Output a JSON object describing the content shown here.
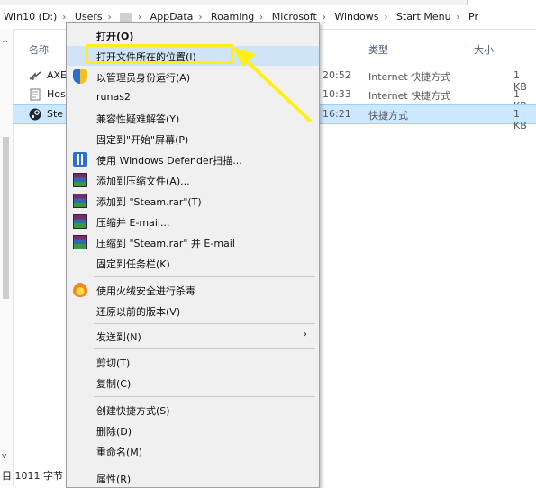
{
  "address": {
    "crumbs": [
      "WIn10 (D:)",
      "Users",
      "",
      "AppData",
      "Roaming",
      "Microsoft",
      "Windows",
      "Start Menu",
      "Pr"
    ],
    "sep": "›"
  },
  "columns": {
    "name": "名称",
    "type": "类型",
    "size": "大小"
  },
  "files": [
    {
      "name": "AXE",
      "time": "20:52",
      "type": "Internet 快捷方式",
      "size": "1 KB",
      "icon": "url-shortcut-icon"
    },
    {
      "name": "Hos",
      "time": "10:33",
      "type": "Internet 快捷方式",
      "size": "1 KB",
      "icon": "document-icon"
    },
    {
      "name": "Ste",
      "time": "16:21",
      "type": "快捷方式",
      "size": "1 KB",
      "icon": "steam-icon",
      "selected": true
    }
  ],
  "status": {
    "text": "目 1011 字节"
  },
  "menu": {
    "items": [
      {
        "label": "打开(O)",
        "bold": true,
        "icon": ""
      },
      {
        "label": "打开文件所在的位置(I)",
        "highlight": true,
        "icon": ""
      },
      {
        "label": "以管理员身份运行(A)",
        "icon": "uac-shield-icon"
      },
      {
        "label": "runas2",
        "icon": ""
      },
      {
        "label": "兼容性疑难解答(Y)",
        "icon": ""
      },
      {
        "label": "固定到\"开始\"屏幕(P)",
        "icon": ""
      },
      {
        "label": "使用 Windows Defender扫描...",
        "icon": "windows-defender-icon"
      },
      {
        "label": "添加到压缩文件(A)...",
        "icon": "winrar-icon"
      },
      {
        "label": "添加到 \"Steam.rar\"(T)",
        "icon": "winrar-icon"
      },
      {
        "label": "压缩并 E-mail...",
        "icon": "winrar-icon"
      },
      {
        "label": "压缩到 \"Steam.rar\" 并 E-mail",
        "icon": "winrar-icon"
      },
      {
        "label": "固定到任务栏(K)",
        "icon": ""
      },
      {
        "label": "使用火绒安全进行杀毒",
        "icon": "huorong-icon"
      },
      {
        "label": "还原以前的版本(V)",
        "icon": ""
      },
      {
        "label": "发送到(N)",
        "icon": "",
        "submenu": true
      },
      {
        "label": "剪切(T)",
        "icon": ""
      },
      {
        "label": "复制(C)",
        "icon": ""
      },
      {
        "label": "创建快捷方式(S)",
        "icon": ""
      },
      {
        "label": "删除(D)",
        "icon": ""
      },
      {
        "label": "重命名(M)",
        "icon": ""
      },
      {
        "label": "属性(R)",
        "icon": ""
      }
    ]
  },
  "colors": {
    "highlight_box": "#ffef1a",
    "selection": "#cce8ff",
    "menu_bg": "#f0f0f0"
  }
}
